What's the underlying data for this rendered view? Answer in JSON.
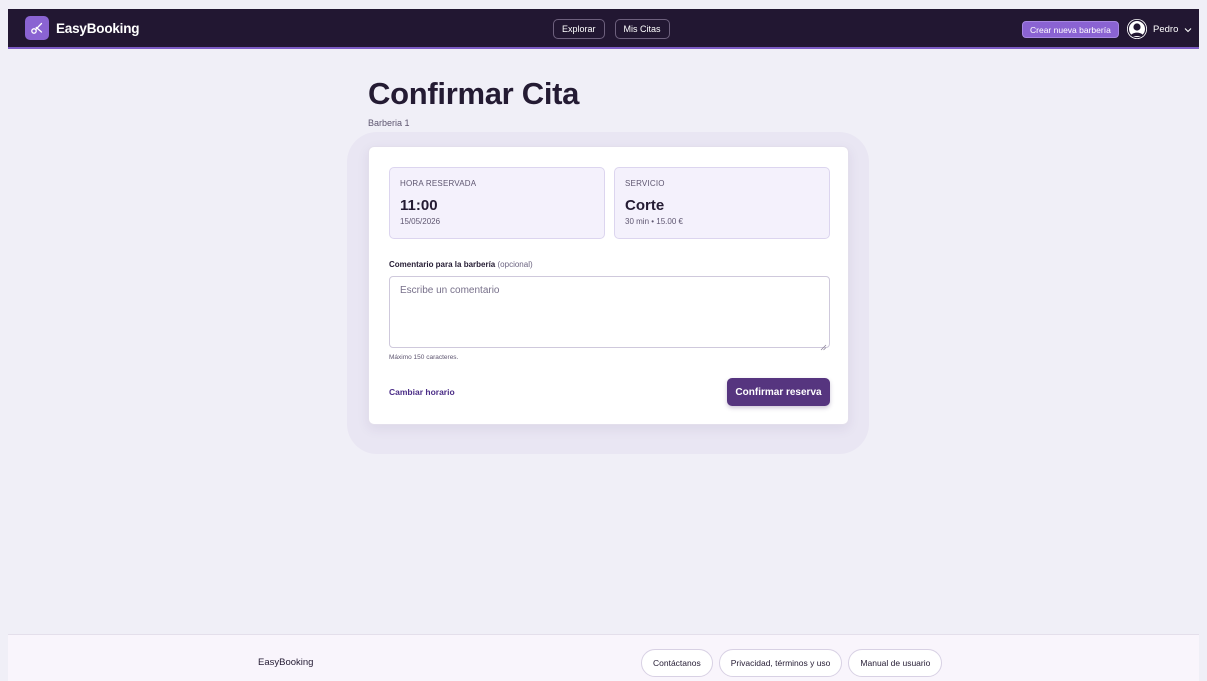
{
  "app": {
    "name": "EasyBooking",
    "accent_color": "#8a63d2",
    "nav_color": "#221732",
    "primary_button_color": "#56357f"
  },
  "nav": {
    "explore_label": "Explorar",
    "appointments_label": "Mis Citas",
    "create_barbershop_label": "Crear nueva barbería",
    "user_name": "Pedro"
  },
  "page": {
    "title": "Confirmar Cita",
    "subtitle": "Barberia 1"
  },
  "booking": {
    "time_label": "HORA RESERVADA",
    "time_value": "11:00",
    "date_value": "15/05/2026",
    "service_label": "SERVICIO",
    "service_value": "Corte",
    "service_details": "30 min • 15.00 €"
  },
  "comment": {
    "label": "Comentario para la barbería",
    "optional_label": "(opcional)",
    "placeholder": "Escribe un comentario",
    "value": "",
    "hint": "Máximo 150 caracteres."
  },
  "actions": {
    "change_time_label": "Cambiar horario",
    "confirm_label": "Confirmar reserva"
  },
  "footer": {
    "brand": "EasyBooking",
    "links": [
      "Contáctanos",
      "Privacidad, términos y uso",
      "Manual de usuario"
    ]
  }
}
